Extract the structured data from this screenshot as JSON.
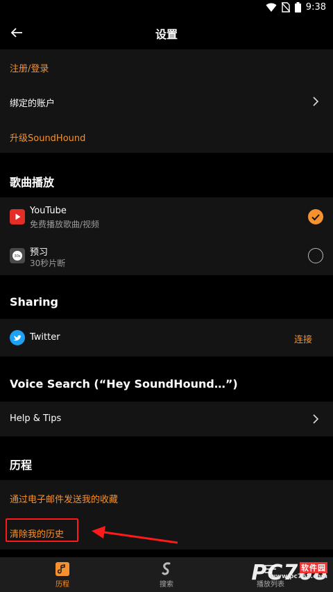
{
  "status_bar": {
    "time": "9:38"
  },
  "header": {
    "title": "设置"
  },
  "account": {
    "register_login": "注册/登录",
    "linked_accounts": "绑定的账户",
    "upgrade": "升级SoundHound"
  },
  "song_playback": {
    "section_title": "歌曲播放",
    "youtube": {
      "name": "YouTube",
      "subtitle": "免费播放歌曲/视频",
      "selected": true
    },
    "preview": {
      "name": "预习",
      "subtitle": "30秒片断",
      "icon_text": "30s",
      "selected": false
    }
  },
  "sharing": {
    "section_title": "Sharing",
    "twitter": {
      "name": "Twitter",
      "action": "连接"
    }
  },
  "voice_search": {
    "section_title": "Voice Search (“Hey SoundHound…”)",
    "help": "Help & Tips"
  },
  "history": {
    "section_title": "历程",
    "email_favorites": "通过电子邮件发送我的收藏",
    "clear_history": "清除我的历史"
  },
  "bottom_nav": {
    "items": [
      {
        "label": "历程",
        "active": true
      },
      {
        "label": "搜索",
        "active": false
      },
      {
        "label": "播放列表",
        "active": false
      }
    ]
  },
  "watermark": {
    "text": "PC768",
    "badge": "软件园",
    "site": "www.pc768.com"
  },
  "colors": {
    "accent": "#f5922f",
    "row_bg": "#141414",
    "page_bg": "#000000",
    "annotation": "#ff1a1a"
  }
}
